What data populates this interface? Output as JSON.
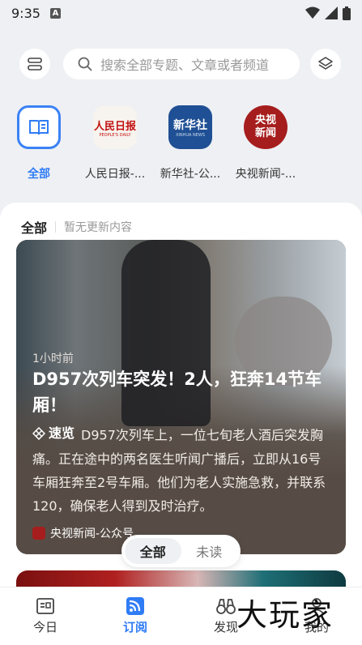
{
  "status": {
    "time": "9:35",
    "notif_letter": "A"
  },
  "search": {
    "placeholder": "搜索全部专题、文章或者频道"
  },
  "channels": [
    {
      "label": "全部",
      "logo_text": ""
    },
    {
      "label": "人民日报-...",
      "logo_text": "人民日报",
      "logo_sub": "PEOPLE'S DAILY"
    },
    {
      "label": "新华社-公...",
      "logo_text": "新华社",
      "logo_sub": "XINHUA NEWS"
    },
    {
      "label": "央视新闻-...",
      "logo_text": "央视新闻"
    }
  ],
  "feed": {
    "title": "全部",
    "subtitle": "暂无更新内容",
    "card": {
      "time": "1小时前",
      "headline": "D957次列车突发！2人，狂奔14节车厢！",
      "quick_label": "速览",
      "summary": "D957次列车上，一位七旬老人酒后突发胸痛。正在途中的两名医生听闻广播后，立即从16号车厢狂奔至2号车厢。他们为老人实施急救，并联系120，确保老人得到及时治疗。",
      "source": "央视新闻-公众号"
    }
  },
  "toggle": {
    "all": "全部",
    "unread": "未读"
  },
  "nav": [
    {
      "label": "今日"
    },
    {
      "label": "订阅"
    },
    {
      "label": "发现"
    },
    {
      "label": "我的"
    }
  ],
  "watermark": "大玩家",
  "colors": {
    "accent": "#2f7cf6",
    "background": "#eef0f3"
  }
}
